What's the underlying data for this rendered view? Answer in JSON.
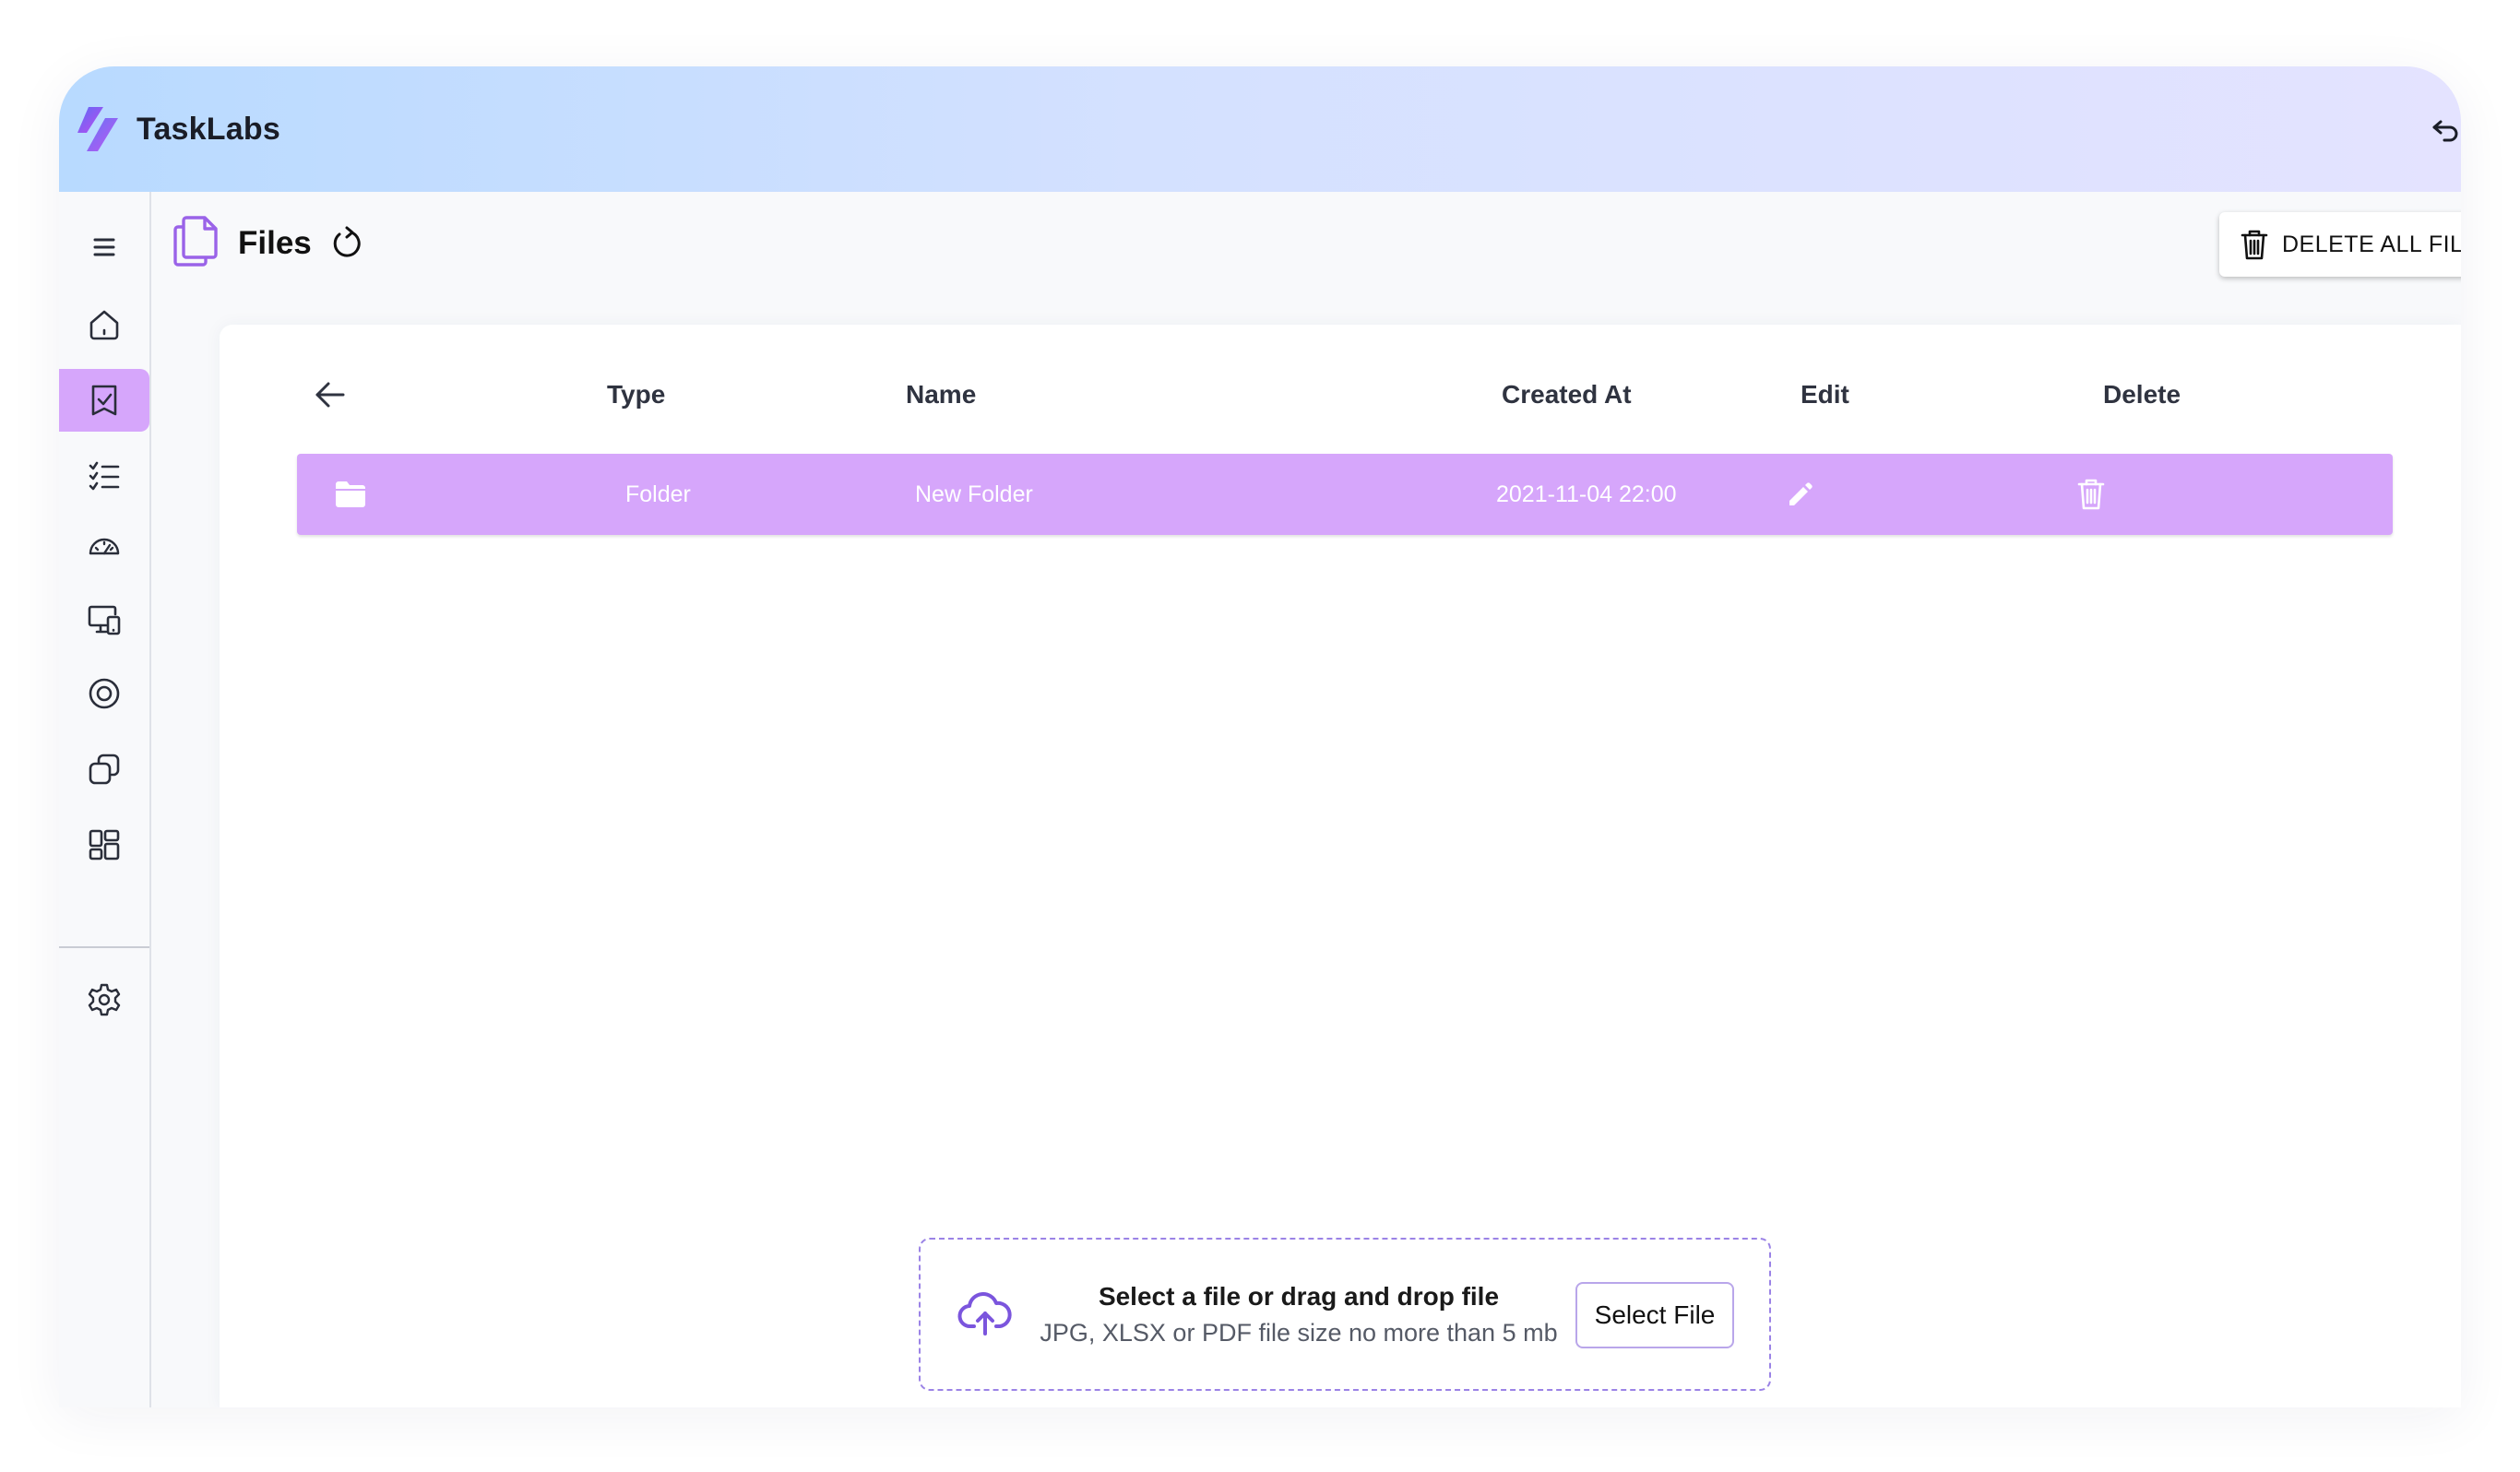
{
  "app": {
    "name": "TaskLabs"
  },
  "page": {
    "title": "Files"
  },
  "toolbar": {
    "delete_all_label": "DELETE ALL FILES"
  },
  "sidebar": {
    "items": [
      {
        "icon": "menu-icon"
      },
      {
        "icon": "home-icon"
      },
      {
        "icon": "tasks-icon",
        "active": true
      },
      {
        "icon": "checklist-icon"
      },
      {
        "icon": "dashboard-gauge-icon"
      },
      {
        "icon": "devices-icon"
      },
      {
        "icon": "target-icon"
      },
      {
        "icon": "copy-shapes-icon"
      },
      {
        "icon": "layout-grid-icon"
      },
      {
        "icon": "settings-icon"
      }
    ]
  },
  "table": {
    "headers": {
      "type": "Type",
      "name": "Name",
      "created_at": "Created At",
      "edit": "Edit",
      "delete": "Delete"
    },
    "rows": [
      {
        "type": "Folder",
        "name": "New Folder",
        "created_at": "2021-11-04 22:00"
      }
    ]
  },
  "upload": {
    "title": "Select a file or drag and drop file",
    "subtitle": "JPG, XLSX or PDF file size no more than 5 mb",
    "button_label": "Select File"
  },
  "colors": {
    "accent_purple": "#d6a6fb",
    "upload_accent": "#7b55dd",
    "topbar_gradient_start": "#b8daff",
    "topbar_gradient_end": "#e4e3ff"
  }
}
